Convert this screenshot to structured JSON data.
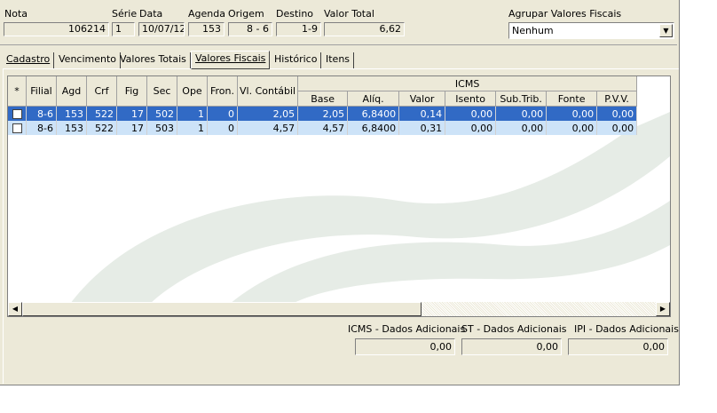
{
  "header": {
    "nota_label": "Nota",
    "nota_value": "106214",
    "serie_label": "Série",
    "serie_value": "1",
    "data_label": "Data",
    "data_value": "10/07/12",
    "agenda_label": "Agenda",
    "agenda_value": "153",
    "origem_label": "Origem",
    "origem_value": "8 - 6",
    "destino_label": "Destino",
    "destino_value": "1-9",
    "valor_total_label": "Valor Total",
    "valor_total_value": "6,62",
    "agrupar_label": "Agrupar Valores Fiscais",
    "agrupar_value": "Nenhum"
  },
  "tabs": [
    {
      "label": "Cadastro"
    },
    {
      "label": "Vencimento"
    },
    {
      "label": "Valores Totais"
    },
    {
      "label": "Valores Fiscais"
    },
    {
      "label": "Histórico"
    },
    {
      "label": "Itens"
    }
  ],
  "grid": {
    "group_header": "ICMS",
    "columns": [
      "*",
      "Filial",
      "Agd",
      "Crf",
      "Fig",
      "Sec",
      "Ope",
      "Fron.",
      "Vl. Contábil",
      "Base",
      "Alíq.",
      "Valor",
      "Isento",
      "Sub.Trib.",
      "Fonte",
      "P.V.V."
    ],
    "rows": [
      {
        "filial": "8-6",
        "agd": "153",
        "crf": "522",
        "fig": "17",
        "sec": "502",
        "ope": "1",
        "fron": "0",
        "vl_contabil": "2,05",
        "base": "2,05",
        "aliq": "6,8400",
        "valor": "0,14",
        "isento": "0,00",
        "sub_trib": "0,00",
        "fonte": "0,00",
        "pvv": "0,00"
      },
      {
        "filial": "8-6",
        "agd": "153",
        "crf": "522",
        "fig": "17",
        "sec": "503",
        "ope": "1",
        "fron": "0",
        "vl_contabil": "4,57",
        "base": "4,57",
        "aliq": "6,8400",
        "valor": "0,31",
        "isento": "0,00",
        "sub_trib": "0,00",
        "fonte": "0,00",
        "pvv": "0,00"
      }
    ]
  },
  "footer": {
    "icms_label": "ICMS - Dados Adicionais",
    "icms_value": "0,00",
    "st_label": "ST - Dados Adicionais",
    "st_value": "0,00",
    "ipi_label": "IPI - Dados Adicionais",
    "ipi_value": "0,00"
  },
  "colors": {
    "panel_bg": "#ece9d8",
    "selected_row": "#316ac5",
    "row_bg": "#cde3f8"
  }
}
